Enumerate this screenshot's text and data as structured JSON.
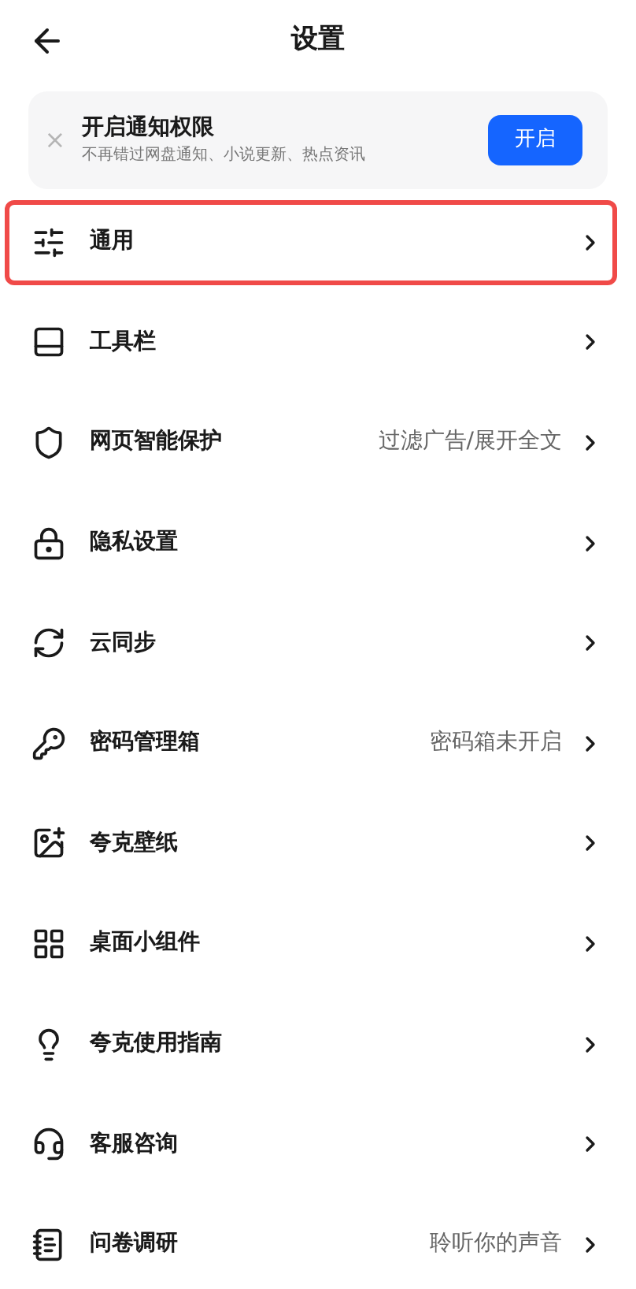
{
  "header": {
    "title": "设置"
  },
  "banner": {
    "title": "开启通知权限",
    "subtitle": "不再错过网盘通知、小说更新、热点资讯",
    "close": "×",
    "button": "开启"
  },
  "items": [
    {
      "kind": "sliders",
      "label": "通用",
      "highlighted": true
    },
    {
      "kind": "toolbar",
      "label": "工具栏",
      "highlighted": false
    },
    {
      "kind": "shield",
      "label": "网页智能保护",
      "value": "过滤广告/展开全文",
      "highlighted": false
    },
    {
      "kind": "lock",
      "label": "隐私设置",
      "highlighted": false
    },
    {
      "kind": "sync",
      "label": "云同步",
      "highlighted": false
    },
    {
      "kind": "key",
      "label": "密码管理箱",
      "value": "密码箱未开启",
      "highlighted": false
    },
    {
      "kind": "wallpaper",
      "label": "夸克壁纸",
      "highlighted": false
    },
    {
      "kind": "widgets",
      "label": "桌面小组件",
      "highlighted": false
    },
    {
      "kind": "bulb",
      "label": "夸克使用指南",
      "highlighted": false
    },
    {
      "kind": "headset",
      "label": "客服咨询",
      "highlighted": false
    },
    {
      "kind": "survey",
      "label": "问卷调研",
      "value": "聆听你的声音",
      "highlighted": false
    }
  ]
}
